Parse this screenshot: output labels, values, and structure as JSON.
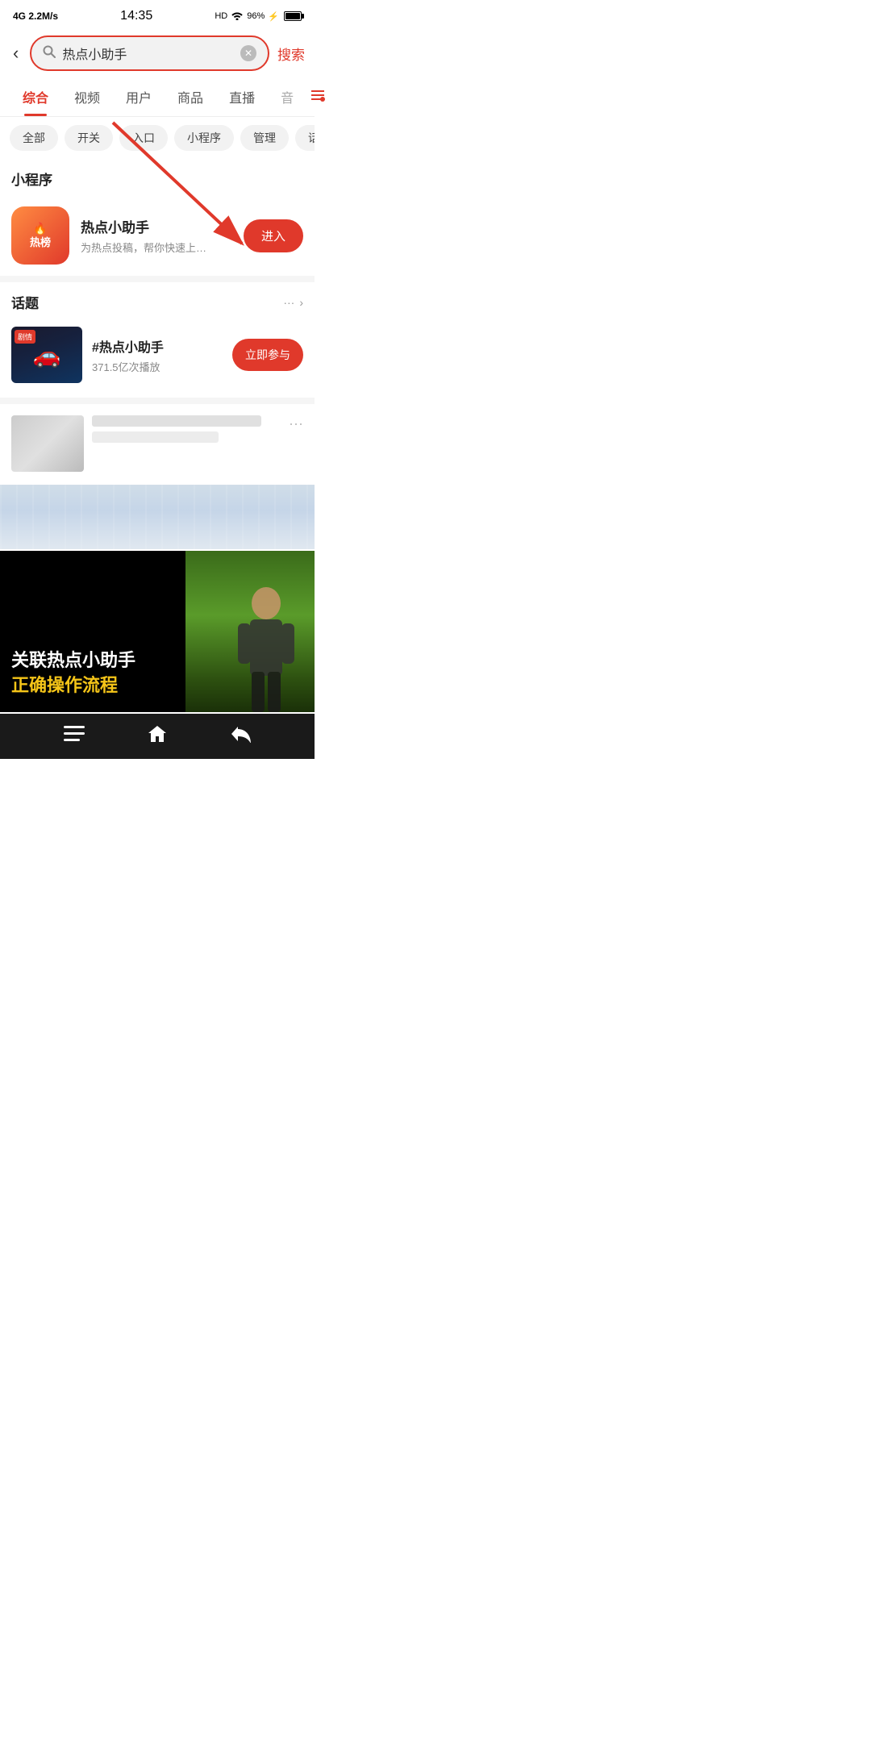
{
  "statusBar": {
    "left": "4G 2.2M/s",
    "time": "14:35",
    "right": "HD 96%"
  },
  "searchBar": {
    "searchText": "热点小助手",
    "searchBtnLabel": "搜索",
    "backIcon": "‹"
  },
  "tabs": [
    {
      "label": "综合",
      "active": true
    },
    {
      "label": "视频",
      "active": false
    },
    {
      "label": "用户",
      "active": false
    },
    {
      "label": "商品",
      "active": false
    },
    {
      "label": "直播",
      "active": false
    },
    {
      "label": "音",
      "active": false,
      "muted": true
    }
  ],
  "filterChips": [
    {
      "label": "全部",
      "active": false
    },
    {
      "label": "开关",
      "active": false
    },
    {
      "label": "入口",
      "active": false
    },
    {
      "label": "小程序",
      "active": false
    },
    {
      "label": "管理",
      "active": false
    },
    {
      "label": "话题",
      "active": false
    }
  ],
  "miniAppSection": {
    "title": "小程序",
    "app": {
      "name": "热点小助手",
      "desc": "为热点投稿，帮你快速上…",
      "btnLabel": "进入",
      "iconText": "热榜"
    }
  },
  "topicSection": {
    "title": "话题",
    "moreLabel": "···",
    "chevron": "›",
    "topic": {
      "name": "#热点小助手",
      "stats": "371.5亿次播放",
      "btnLabel": "立即参与",
      "badge": "剧情"
    }
  },
  "videoCard": {
    "titleLine1": "关联热点小助手",
    "titleLine2": "正确操作流程"
  },
  "annotation": {
    "arrowText": "→"
  },
  "bottomNav": {
    "menuIcon": "☰",
    "homeIcon": "⌂",
    "backIcon": "↩"
  }
}
